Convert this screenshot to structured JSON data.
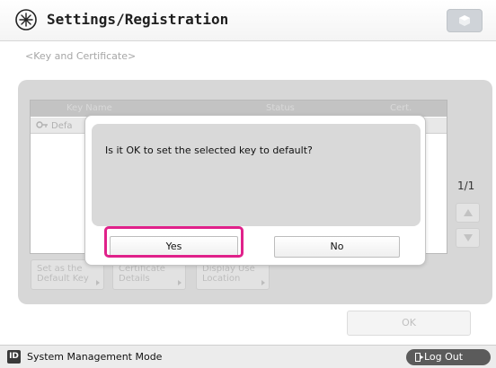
{
  "header": {
    "title": "Settings/Registration",
    "icon": "settings-registration-icon",
    "cube_icon": "cube-icon"
  },
  "breadcrumb": "<Key and Certificate>",
  "list": {
    "columns": [
      "Key Name",
      "Status",
      "Cert."
    ],
    "rows": [
      {
        "key_name": "Defa"
      }
    ]
  },
  "pagination": {
    "page": "1/1"
  },
  "function_buttons": {
    "set_default": [
      "Set as the",
      "Default Key"
    ],
    "cert_details": [
      "Certificate",
      "Details"
    ],
    "display_use": [
      "Display Use",
      "Location"
    ]
  },
  "footer": {
    "ok_label": "OK"
  },
  "dialog": {
    "message": "Is it OK to set the selected key to default?",
    "yes_label": "Yes",
    "no_label": "No"
  },
  "statusbar": {
    "mode_badge": "ID",
    "mode_text": "System Management Mode",
    "logout_label": "Log Out"
  },
  "colors": {
    "highlight": "#e0218a",
    "panel": "#d7d7d7"
  }
}
